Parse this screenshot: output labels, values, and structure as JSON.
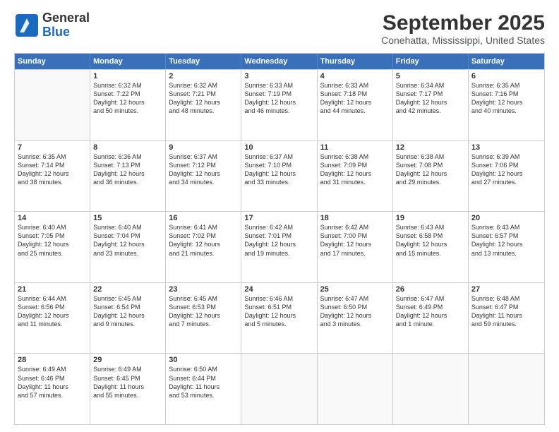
{
  "logo": {
    "line1": "General",
    "line2": "Blue"
  },
  "title": "September 2025",
  "subtitle": "Conehatta, Mississippi, United States",
  "weekdays": [
    "Sunday",
    "Monday",
    "Tuesday",
    "Wednesday",
    "Thursday",
    "Friday",
    "Saturday"
  ],
  "rows": [
    [
      {
        "day": "",
        "lines": []
      },
      {
        "day": "1",
        "lines": [
          "Sunrise: 6:32 AM",
          "Sunset: 7:22 PM",
          "Daylight: 12 hours",
          "and 50 minutes."
        ]
      },
      {
        "day": "2",
        "lines": [
          "Sunrise: 6:32 AM",
          "Sunset: 7:21 PM",
          "Daylight: 12 hours",
          "and 48 minutes."
        ]
      },
      {
        "day": "3",
        "lines": [
          "Sunrise: 6:33 AM",
          "Sunset: 7:19 PM",
          "Daylight: 12 hours",
          "and 46 minutes."
        ]
      },
      {
        "day": "4",
        "lines": [
          "Sunrise: 6:33 AM",
          "Sunset: 7:18 PM",
          "Daylight: 12 hours",
          "and 44 minutes."
        ]
      },
      {
        "day": "5",
        "lines": [
          "Sunrise: 6:34 AM",
          "Sunset: 7:17 PM",
          "Daylight: 12 hours",
          "and 42 minutes."
        ]
      },
      {
        "day": "6",
        "lines": [
          "Sunrise: 6:35 AM",
          "Sunset: 7:16 PM",
          "Daylight: 12 hours",
          "and 40 minutes."
        ]
      }
    ],
    [
      {
        "day": "7",
        "lines": [
          "Sunrise: 6:35 AM",
          "Sunset: 7:14 PM",
          "Daylight: 12 hours",
          "and 38 minutes."
        ]
      },
      {
        "day": "8",
        "lines": [
          "Sunrise: 6:36 AM",
          "Sunset: 7:13 PM",
          "Daylight: 12 hours",
          "and 36 minutes."
        ]
      },
      {
        "day": "9",
        "lines": [
          "Sunrise: 6:37 AM",
          "Sunset: 7:12 PM",
          "Daylight: 12 hours",
          "and 34 minutes."
        ]
      },
      {
        "day": "10",
        "lines": [
          "Sunrise: 6:37 AM",
          "Sunset: 7:10 PM",
          "Daylight: 12 hours",
          "and 33 minutes."
        ]
      },
      {
        "day": "11",
        "lines": [
          "Sunrise: 6:38 AM",
          "Sunset: 7:09 PM",
          "Daylight: 12 hours",
          "and 31 minutes."
        ]
      },
      {
        "day": "12",
        "lines": [
          "Sunrise: 6:38 AM",
          "Sunset: 7:08 PM",
          "Daylight: 12 hours",
          "and 29 minutes."
        ]
      },
      {
        "day": "13",
        "lines": [
          "Sunrise: 6:39 AM",
          "Sunset: 7:06 PM",
          "Daylight: 12 hours",
          "and 27 minutes."
        ]
      }
    ],
    [
      {
        "day": "14",
        "lines": [
          "Sunrise: 6:40 AM",
          "Sunset: 7:05 PM",
          "Daylight: 12 hours",
          "and 25 minutes."
        ]
      },
      {
        "day": "15",
        "lines": [
          "Sunrise: 6:40 AM",
          "Sunset: 7:04 PM",
          "Daylight: 12 hours",
          "and 23 minutes."
        ]
      },
      {
        "day": "16",
        "lines": [
          "Sunrise: 6:41 AM",
          "Sunset: 7:02 PM",
          "Daylight: 12 hours",
          "and 21 minutes."
        ]
      },
      {
        "day": "17",
        "lines": [
          "Sunrise: 6:42 AM",
          "Sunset: 7:01 PM",
          "Daylight: 12 hours",
          "and 19 minutes."
        ]
      },
      {
        "day": "18",
        "lines": [
          "Sunrise: 6:42 AM",
          "Sunset: 7:00 PM",
          "Daylight: 12 hours",
          "and 17 minutes."
        ]
      },
      {
        "day": "19",
        "lines": [
          "Sunrise: 6:43 AM",
          "Sunset: 6:58 PM",
          "Daylight: 12 hours",
          "and 15 minutes."
        ]
      },
      {
        "day": "20",
        "lines": [
          "Sunrise: 6:43 AM",
          "Sunset: 6:57 PM",
          "Daylight: 12 hours",
          "and 13 minutes."
        ]
      }
    ],
    [
      {
        "day": "21",
        "lines": [
          "Sunrise: 6:44 AM",
          "Sunset: 6:56 PM",
          "Daylight: 12 hours",
          "and 11 minutes."
        ]
      },
      {
        "day": "22",
        "lines": [
          "Sunrise: 6:45 AM",
          "Sunset: 6:54 PM",
          "Daylight: 12 hours",
          "and 9 minutes."
        ]
      },
      {
        "day": "23",
        "lines": [
          "Sunrise: 6:45 AM",
          "Sunset: 6:53 PM",
          "Daylight: 12 hours",
          "and 7 minutes."
        ]
      },
      {
        "day": "24",
        "lines": [
          "Sunrise: 6:46 AM",
          "Sunset: 6:51 PM",
          "Daylight: 12 hours",
          "and 5 minutes."
        ]
      },
      {
        "day": "25",
        "lines": [
          "Sunrise: 6:47 AM",
          "Sunset: 6:50 PM",
          "Daylight: 12 hours",
          "and 3 minutes."
        ]
      },
      {
        "day": "26",
        "lines": [
          "Sunrise: 6:47 AM",
          "Sunset: 6:49 PM",
          "Daylight: 12 hours",
          "and 1 minute."
        ]
      },
      {
        "day": "27",
        "lines": [
          "Sunrise: 6:48 AM",
          "Sunset: 6:47 PM",
          "Daylight: 11 hours",
          "and 59 minutes."
        ]
      }
    ],
    [
      {
        "day": "28",
        "lines": [
          "Sunrise: 6:49 AM",
          "Sunset: 6:46 PM",
          "Daylight: 11 hours",
          "and 57 minutes."
        ]
      },
      {
        "day": "29",
        "lines": [
          "Sunrise: 6:49 AM",
          "Sunset: 6:45 PM",
          "Daylight: 11 hours",
          "and 55 minutes."
        ]
      },
      {
        "day": "30",
        "lines": [
          "Sunrise: 6:50 AM",
          "Sunset: 6:44 PM",
          "Daylight: 11 hours",
          "and 53 minutes."
        ]
      },
      {
        "day": "",
        "lines": []
      },
      {
        "day": "",
        "lines": []
      },
      {
        "day": "",
        "lines": []
      },
      {
        "day": "",
        "lines": []
      }
    ]
  ]
}
